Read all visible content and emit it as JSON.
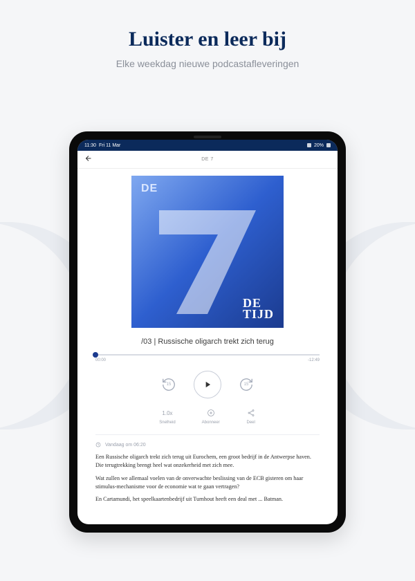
{
  "promo": {
    "title": "Luister en leer bij",
    "subtitle": "Elke weekdag nieuwe podcastafleveringen"
  },
  "statusbar": {
    "time": "11:30",
    "date": "Fri 11 Mar",
    "battery": "20%"
  },
  "header": {
    "title": "DE 7"
  },
  "cover": {
    "de_label": "DE",
    "brand_line1": "DE",
    "brand_line2": "TIJD"
  },
  "episode": {
    "title": "/03 | Russische oligarch trekt zich terug",
    "time_elapsed": "00:00",
    "time_remaining": "-12:49"
  },
  "controls": {
    "skip_back_seconds": "15",
    "skip_fwd_seconds": "15"
  },
  "meta": {
    "speed_value": "1.0x",
    "speed_label": "Snelheid",
    "subscribe_label": "Abonneer",
    "share_label": "Deel"
  },
  "timestamp": "Vandaag om 06:20",
  "description": {
    "p1": "Een Russische oligarch trekt zich terug uit Eurochem, een groot bedrijf in de Antwerpse haven. Die terugtrekking brengt heel wat onzekerheid met zich mee.",
    "p2": "Wat zullen we allemaal voelen van de onverwachte beslissing van de ECB gisteren om haar stimulus-mechanisme voor de economie wat te gaan vertragen?",
    "p3": "En Cartamundi, het speelkaartenbedrijf uit Turnhout heeft een deal met ... Batman."
  }
}
